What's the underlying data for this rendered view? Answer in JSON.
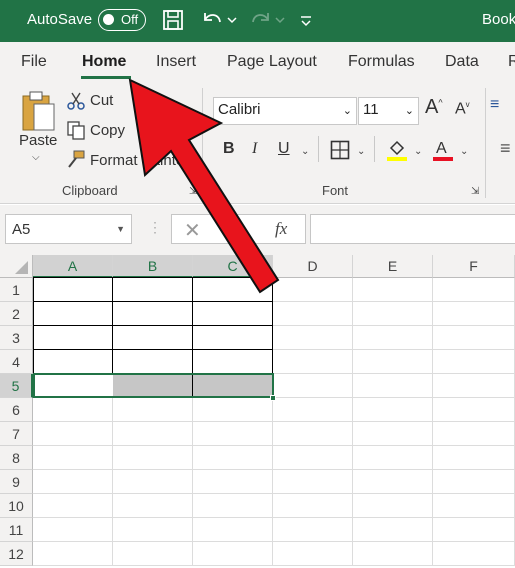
{
  "titlebar": {
    "autosave_label": "AutoSave",
    "autosave_state": "Off",
    "book_title": "Book"
  },
  "tabs": [
    {
      "label": "File",
      "active": false
    },
    {
      "label": "Home",
      "active": true
    },
    {
      "label": "Insert",
      "active": false
    },
    {
      "label": "Page Layout",
      "active": false
    },
    {
      "label": "Formulas",
      "active": false
    },
    {
      "label": "Data",
      "active": false
    },
    {
      "label": "R",
      "active": false
    }
  ],
  "clipboard": {
    "paste_label": "Paste",
    "cut_label": "Cut",
    "copy_label": "Copy",
    "format_painter_label": "Format Painter",
    "group_label": "Clipboard"
  },
  "font": {
    "font_name": "Calibri",
    "font_size": "11",
    "bold": "B",
    "italic": "I",
    "underline": "U",
    "group_label": "Font",
    "highlight_color": "#ffff00",
    "font_color": "#e81123"
  },
  "formula_bar": {
    "name_box": "A5",
    "fx_label": "fx",
    "formula": ""
  },
  "grid": {
    "columns": [
      "A",
      "B",
      "C",
      "D",
      "E",
      "F"
    ],
    "rows": [
      "1",
      "2",
      "3",
      "4",
      "5",
      "6",
      "7",
      "8",
      "9",
      "10",
      "11",
      "12"
    ],
    "active_cell": "A5",
    "selected_range": "A5:C5"
  },
  "colors": {
    "excel_green": "#217346",
    "arrow_red": "#e8141c"
  },
  "icons": [
    "save-icon",
    "undo-icon",
    "redo-icon",
    "customize-qat-icon",
    "paste-icon",
    "cut-icon",
    "copy-icon",
    "format-painter-icon",
    "grow-font-icon",
    "shrink-font-icon",
    "borders-icon",
    "highlight-icon",
    "font-color-icon",
    "cancel-icon",
    "enter-icon",
    "red-arrow-annotation"
  ]
}
